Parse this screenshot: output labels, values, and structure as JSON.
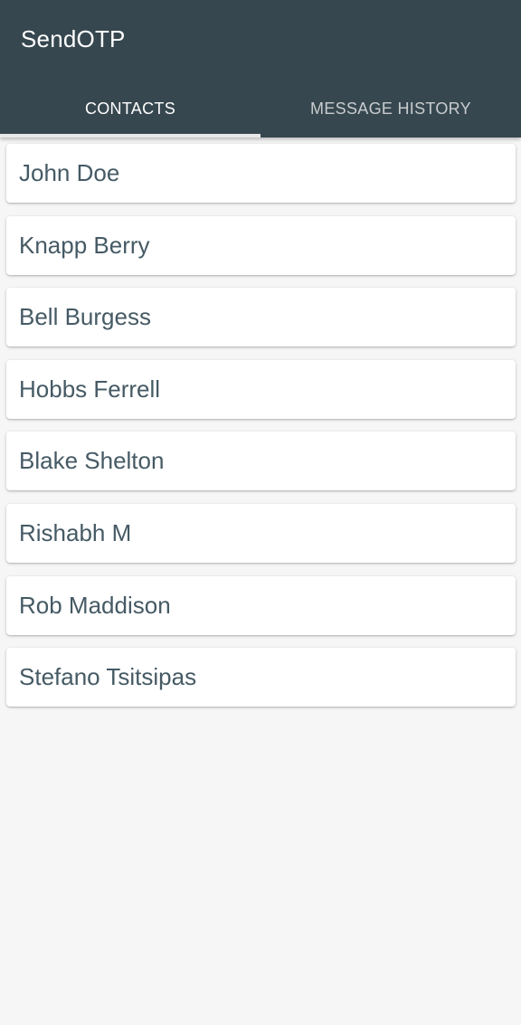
{
  "app": {
    "title": "SendOTP"
  },
  "tabs": [
    {
      "label": "CONTACTS",
      "active": true
    },
    {
      "label": "MESSAGE HISTORY",
      "active": false
    }
  ],
  "contacts": [
    {
      "name": "John Doe"
    },
    {
      "name": "Knapp Berry"
    },
    {
      "name": "Bell Burgess"
    },
    {
      "name": "Hobbs Ferrell"
    },
    {
      "name": "Blake Shelton"
    },
    {
      "name": "Rishabh M"
    },
    {
      "name": "Rob Maddison"
    },
    {
      "name": "Stefano Tsitsipas"
    }
  ],
  "colors": {
    "appbar": "#37474f",
    "background": "#f6f6f6",
    "card": "#ffffff",
    "contact_text": "#455a64",
    "tab_indicator": "#e8e8e8"
  }
}
